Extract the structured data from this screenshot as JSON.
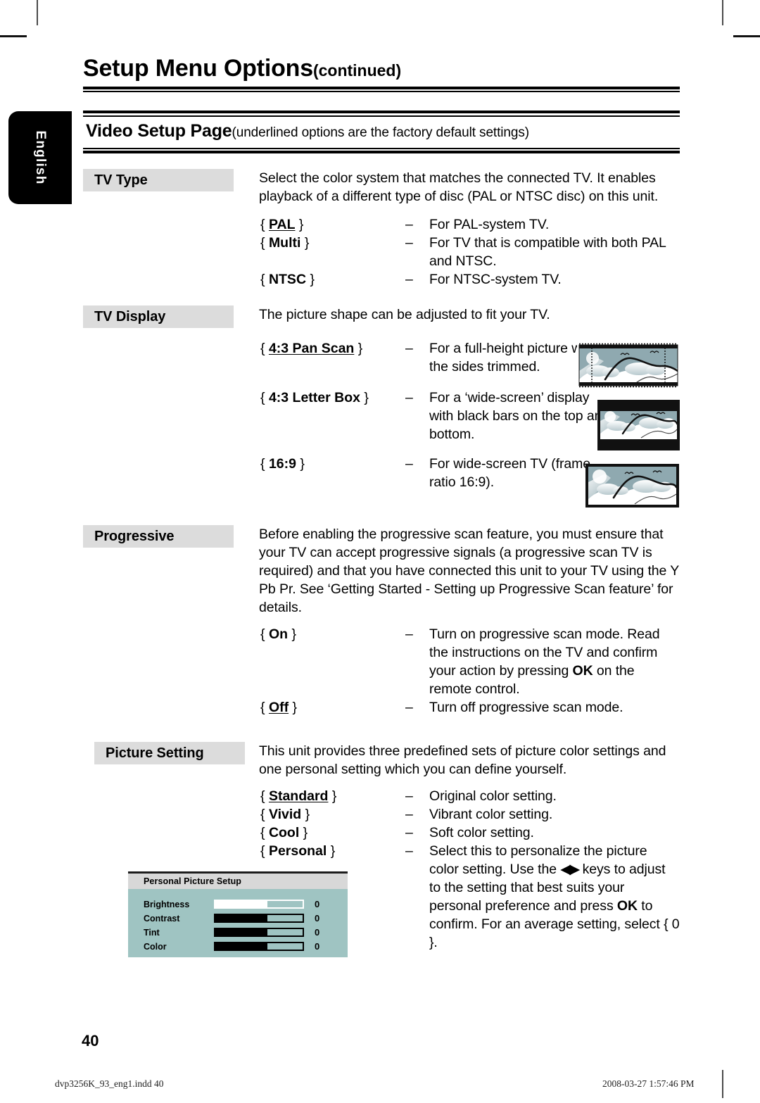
{
  "language_tab": {
    "label": "English"
  },
  "header": {
    "title": "Setup Menu Options",
    "continued": "(continued)"
  },
  "section": {
    "title": "Video Setup Page",
    "note": "(underlined options are the factory default settings)"
  },
  "blocks": [
    {
      "label": "TV Type",
      "description": "Select the color system that matches the connected TV. It enables playback of a different type of disc (PAL or NTSC disc) on this unit.",
      "options": [
        {
          "open": "{",
          "name": "PAL",
          "close": "}",
          "underlined": true,
          "dash": "–",
          "text": "For PAL-system TV."
        },
        {
          "open": "{",
          "name": "Multi",
          "close": "}",
          "underlined": false,
          "dash": "–",
          "text": "For TV that is compatible with both PAL and NTSC."
        },
        {
          "open": "{",
          "name": "NTSC",
          "close": "}",
          "underlined": false,
          "dash": "–",
          "text": "For NTSC-system TV."
        }
      ]
    },
    {
      "label": "TV Display",
      "description": "The picture shape can be adjusted to fit your TV.",
      "options": [
        {
          "open": "{",
          "name": "4:3 Pan Scan",
          "close": "}",
          "underlined": true,
          "dash": "–",
          "text": "For a full-height picture with the sides trimmed."
        },
        {
          "open": "{",
          "name": "4:3 Letter Box",
          "close": "}",
          "underlined": false,
          "dash": "–",
          "text": "For a ‘wide-screen’ display with black bars on the top and bottom."
        },
        {
          "open": "{",
          "name": "16:9",
          "close": "}",
          "underlined": false,
          "dash": "–",
          "text": "For wide-screen TV (frame ratio 16:9)."
        }
      ]
    },
    {
      "label": "Progressive",
      "description": "Before enabling the progressive scan feature, you must ensure that your TV can accept progressive signals (a progressive scan TV is required) and that you have connected this unit to your TV using the Y Pb Pr. See ‘Getting Started - Setting up Progressive Scan feature’ for details.",
      "options": [
        {
          "open": "{",
          "name": "On",
          "close": "}",
          "underlined": false,
          "dash": "–",
          "text_pre": "Turn on progressive scan mode. Read the instructions on the TV and confirm your action by pressing ",
          "text_key": "OK",
          "text_post": " on the remote control."
        },
        {
          "open": "{",
          "name": "Off",
          "close": "}",
          "underlined": true,
          "dash": "–",
          "text": "Turn off progressive scan mode."
        }
      ]
    },
    {
      "label": "Picture Setting",
      "description": "This unit provides three predefined sets of picture color settings and one personal setting which you can define yourself.",
      "options": [
        {
          "open": "{",
          "name": "Standard",
          "close": "}",
          "underlined": true,
          "dash": "–",
          "text": "Original color setting."
        },
        {
          "open": "{",
          "name": "Vivid",
          "close": "}",
          "underlined": false,
          "dash": "–",
          "text": "Vibrant color setting."
        },
        {
          "open": "{",
          "name": "Cool",
          "close": "}",
          "underlined": false,
          "dash": "–",
          "text": "Soft color setting."
        },
        {
          "open": "{",
          "name": "Personal",
          "close": "}",
          "underlined": false,
          "dash": "–",
          "text_pre": "Select this to personalize the picture color setting. Use the ",
          "text_keys": "◀▶",
          "text_mid": " keys to adjust to the setting that best suits your personal preference and press ",
          "text_key": "OK",
          "text_post": " to confirm. For an average setting, select { 0 }."
        }
      ]
    }
  ],
  "osd": {
    "title": "Personal Picture Setup",
    "rows": [
      {
        "label": "Brightness",
        "value": "0",
        "selected": true
      },
      {
        "label": "Contrast",
        "value": "0",
        "selected": false
      },
      {
        "label": "Tint",
        "value": "0",
        "selected": false
      },
      {
        "label": "Color",
        "value": "0",
        "selected": false
      }
    ]
  },
  "footer": {
    "page_number": "40",
    "left": "dvp3256K_93_eng1.indd   40",
    "right": "2008-03-27   1:57:46 PM"
  },
  "colors": {
    "label_box_bg": "#dcdcdc",
    "osd_bg": "#9fc4c2",
    "osd_title_bg": "#d8d8d8",
    "sky": "#8fa9b0",
    "tab_bg": "#000000"
  }
}
